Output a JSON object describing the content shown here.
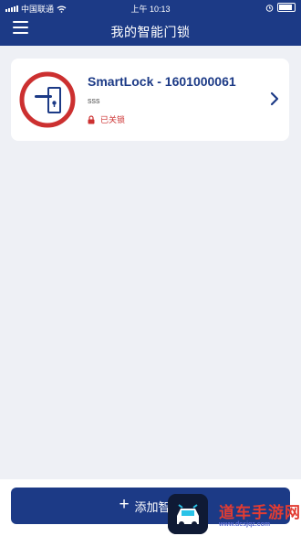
{
  "status_bar": {
    "carrier": "中国联通",
    "time": "上午 10:13"
  },
  "header": {
    "title": "我的智能门锁"
  },
  "lock_card": {
    "name": "SmartLock - 1601000061",
    "subtitle": "sss",
    "status": "已关锁"
  },
  "footer": {
    "add_button_label": "添加智能"
  },
  "watermark": {
    "text": "道车手游网",
    "url": "www.dcsjqz.com"
  },
  "colors": {
    "brand": "#1c3a86",
    "locked_red": "#cc3030",
    "background": "#eef0f5"
  }
}
